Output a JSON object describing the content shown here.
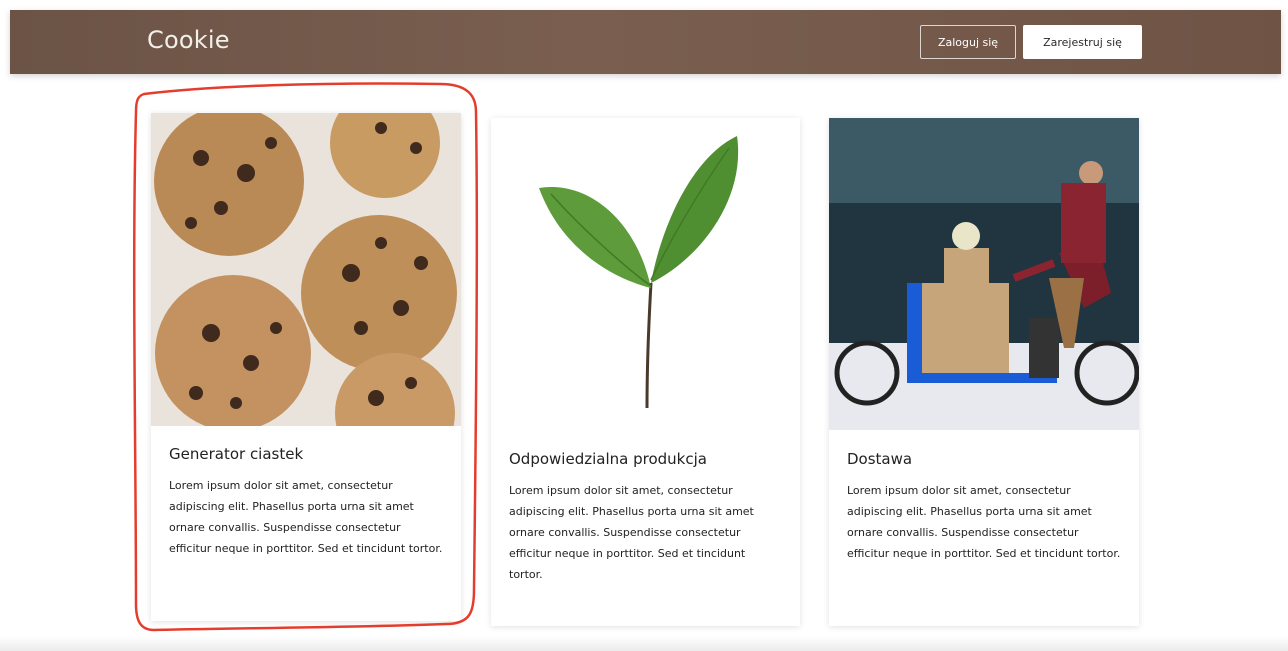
{
  "header": {
    "brand": "Cookie",
    "login_label": "Zaloguj się",
    "register_label": "Zarejestruj się",
    "bg_color": "#6b5345"
  },
  "cards": [
    {
      "title": "Generator ciastek",
      "text": "Lorem ipsum dolor sit amet, consectetur adipiscing elit. Phasellus porta urna sit amet ornare convallis. Suspendisse consectetur efficitur neque in porttitor. Sed et tincidunt tortor."
    },
    {
      "title": "Odpowiedzialna produkcja",
      "text": "Lorem ipsum dolor sit amet, consectetur adipiscing elit. Phasellus porta urna sit amet ornare convallis. Suspendisse consectetur efficitur neque in porttitor. Sed et tincidunt tortor."
    },
    {
      "title": "Dostawa",
      "text": "Lorem ipsum dolor sit amet, consectetur adipiscing elit. Phasellus porta urna sit amet ornare convallis. Suspendisse consectetur efficitur neque in porttitor. Sed et tincidunt tortor."
    }
  ],
  "colors": {
    "annotation": "#e53d2d",
    "card_shadow": "#d9d9d9"
  }
}
